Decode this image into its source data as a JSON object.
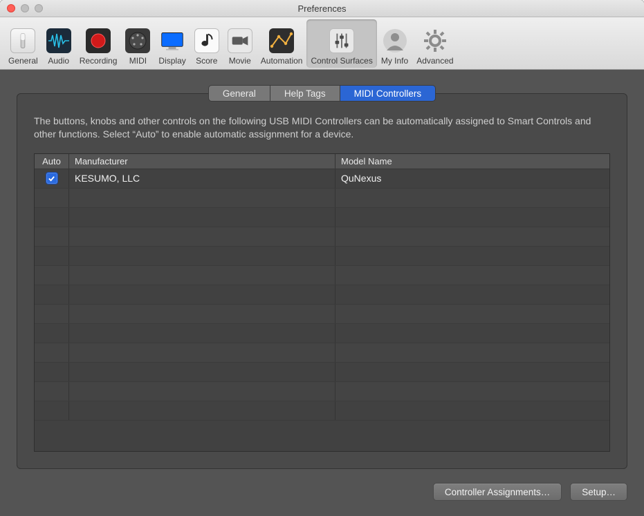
{
  "window": {
    "title": "Preferences"
  },
  "toolbar": {
    "items": [
      {
        "label": "General"
      },
      {
        "label": "Audio"
      },
      {
        "label": "Recording"
      },
      {
        "label": "MIDI"
      },
      {
        "label": "Display"
      },
      {
        "label": "Score"
      },
      {
        "label": "Movie"
      },
      {
        "label": "Automation"
      },
      {
        "label": "Control Surfaces"
      },
      {
        "label": "My Info"
      },
      {
        "label": "Advanced"
      }
    ],
    "selected_index": 8
  },
  "subtabs": {
    "items": [
      {
        "label": "General"
      },
      {
        "label": "Help Tags"
      },
      {
        "label": "MIDI Controllers"
      }
    ],
    "active_index": 2
  },
  "panel": {
    "description": "The buttons, knobs and other controls on the following USB MIDI Controllers can be automatically assigned to Smart Controls and other functions. Select “Auto” to enable automatic assignment for a device."
  },
  "table": {
    "columns": {
      "auto": "Auto",
      "manufacturer": "Manufacturer",
      "model": "Model Name"
    },
    "rows": [
      {
        "auto": true,
        "manufacturer": "KESUMO, LLC",
        "model": "QuNexus"
      }
    ],
    "empty_row_count": 12
  },
  "footer": {
    "assignments": "Controller Assignments…",
    "setup": "Setup…"
  }
}
